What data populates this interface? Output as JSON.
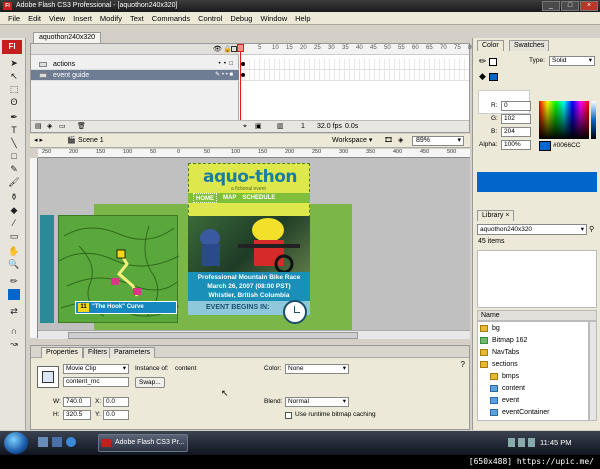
{
  "window": {
    "title": "Adobe Flash CS3 Professional - [aquothon240x320]"
  },
  "menu": [
    "File",
    "Edit",
    "View",
    "Insert",
    "Modify",
    "Text",
    "Commands",
    "Control",
    "Debug",
    "Window",
    "Help"
  ],
  "tools": {
    "logo": "Fl"
  },
  "document": {
    "tab": "aquothon240x320"
  },
  "timeline": {
    "layers": [
      {
        "name": "actions",
        "selected": false
      },
      {
        "name": "event guide",
        "selected": true
      }
    ],
    "ruler": [
      "5",
      "10",
      "15",
      "20",
      "25",
      "30",
      "35",
      "40",
      "45",
      "50",
      "55",
      "60",
      "65",
      "70",
      "75",
      "80"
    ],
    "status": {
      "frame": "1",
      "fps": "32.0 fps",
      "time": "0.0s"
    }
  },
  "editbar": {
    "scene": "Scene 1",
    "workspace": "Workspace",
    "zoom": "89%"
  },
  "hruler": [
    "250",
    "200",
    "150",
    "100",
    "50",
    "0",
    "50",
    "100",
    "150",
    "200",
    "250",
    "300",
    "350",
    "400",
    "450",
    "500"
  ],
  "stage": {
    "logo": "aquo-thon",
    "logo_sub": "a fictional event",
    "nav": [
      "HOME",
      "MAP",
      "SCHEDULE"
    ],
    "caption_num": "11",
    "caption": "\"The Hook\" Curve",
    "info_lines": [
      "Professional Mountain Bike Race",
      "March 26, 2007 (08:00 PST)",
      "Whistler, British Columbia"
    ],
    "event_begins": "EVENT BEGINS IN:"
  },
  "properties": {
    "tabs": [
      "Properties",
      "Filters",
      "Parameters"
    ],
    "symbol_type": "Movie Clip",
    "instance_label": "Instance of:",
    "instance_of": "content",
    "instance_name": "content_mc",
    "swap": "Swap...",
    "w_label": "W:",
    "w": "740.0",
    "h_label": "H:",
    "h": "320.5",
    "x_label": "X:",
    "x": "0.0",
    "y_label": "Y:",
    "y": "0.0",
    "color_label": "Color:",
    "color": "None",
    "blend_label": "Blend:",
    "blend": "Normal",
    "bitmap_caching": "Use runtime bitmap caching"
  },
  "color_panel": {
    "tabs": [
      "Color",
      "Swatches"
    ],
    "type_label": "Type:",
    "type": "Solid",
    "r_label": "R:",
    "r": "0",
    "g_label": "G:",
    "g": "102",
    "b_label": "B:",
    "b": "204",
    "alpha_label": "Alpha:",
    "alpha": "100%",
    "hex": "#0066CC",
    "swatch": "#0066cc"
  },
  "library": {
    "tab": "Library",
    "doc": "aquothon240x320",
    "count": "45 items",
    "header": "Name",
    "items": [
      {
        "name": "bg",
        "type": "folder"
      },
      {
        "name": "Bitmap 162",
        "type": "bmp"
      },
      {
        "name": "NavTabs",
        "type": "folder"
      },
      {
        "name": "sections",
        "type": "folder"
      },
      {
        "name": "bmps",
        "type": "folder"
      },
      {
        "name": "content",
        "type": "mc"
      },
      {
        "name": "event",
        "type": "mc"
      },
      {
        "name": "eventContainer",
        "type": "mc"
      }
    ]
  },
  "taskbar": {
    "task": "Adobe Flash CS3 Pr...",
    "clock": "11:45 PM"
  },
  "watermark": "[650x488] https://upic.me/"
}
